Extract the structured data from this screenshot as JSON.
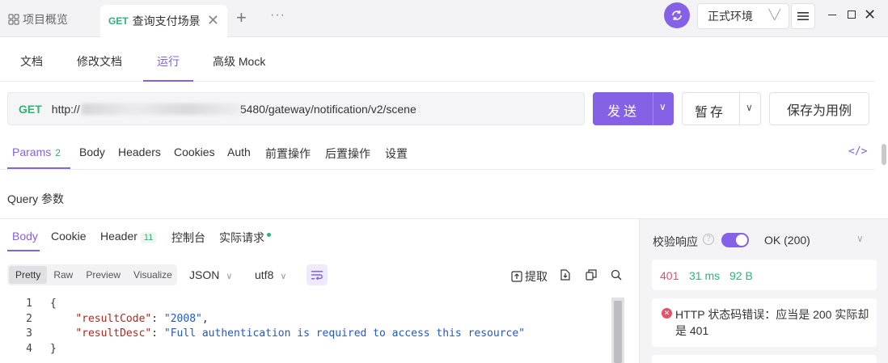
{
  "tabbar": {
    "overview_label": "项目概览",
    "active_tab": {
      "method": "GET",
      "name": "查询支付场景"
    },
    "more": "···",
    "env": "正式环境"
  },
  "subnav": {
    "items": [
      "文档",
      "修改文档",
      "运行",
      "高级 Mock"
    ],
    "active": "运行"
  },
  "request": {
    "method": "GET",
    "url_prefix": "http://",
    "url_suffix": "5480/gateway/notification/v2/scene",
    "send_label": "发送",
    "save_label": "暂存",
    "save_case_label": "保存为用例"
  },
  "params_tabs": {
    "items": [
      {
        "label": "Params",
        "badge": "2"
      },
      {
        "label": "Body"
      },
      {
        "label": "Headers"
      },
      {
        "label": "Cookies"
      },
      {
        "label": "Auth"
      },
      {
        "label": "前置操作"
      },
      {
        "label": "后置操作"
      },
      {
        "label": "设置"
      }
    ],
    "code_icon": "</>"
  },
  "query_label": "Query 参数",
  "response": {
    "tabs": [
      {
        "label": "Body"
      },
      {
        "label": "Cookie"
      },
      {
        "label": "Header",
        "badge": "11"
      },
      {
        "label": "控制台"
      },
      {
        "label": "实际请求"
      }
    ],
    "view_modes": [
      "Pretty",
      "Raw",
      "Preview",
      "Visualize"
    ],
    "format": "JSON",
    "encoding": "utf8",
    "extract_label": "提取",
    "code_lines": [
      {
        "n": "1",
        "parts": [
          [
            "p",
            "{"
          ]
        ]
      },
      {
        "n": "2",
        "parts": [
          [
            "p",
            "    "
          ],
          [
            "k",
            "\"resultCode\""
          ],
          [
            "p",
            ": "
          ],
          [
            "s",
            "\"2008\""
          ],
          [
            "p",
            ","
          ]
        ]
      },
      {
        "n": "3",
        "parts": [
          [
            "p",
            "    "
          ],
          [
            "k",
            "\"resultDesc\""
          ],
          [
            "p",
            ": "
          ],
          [
            "s",
            "\"Full authentication is required to access this resource\""
          ]
        ]
      },
      {
        "n": "4",
        "parts": [
          [
            "p",
            "}"
          ]
        ]
      }
    ]
  },
  "validation": {
    "label": "校验响应",
    "help": "?",
    "status": "OK (200)",
    "stats": {
      "code": "401",
      "time": "31 ms",
      "size": "92 B"
    },
    "error": "HTTP 状态码错误：应当是 200 实际却是 401",
    "error_icon": "✕"
  },
  "colors": {
    "accent": "#8561e6",
    "get_method": "#2bb673",
    "error": "#e8506a",
    "time_green": "#2bb673"
  }
}
